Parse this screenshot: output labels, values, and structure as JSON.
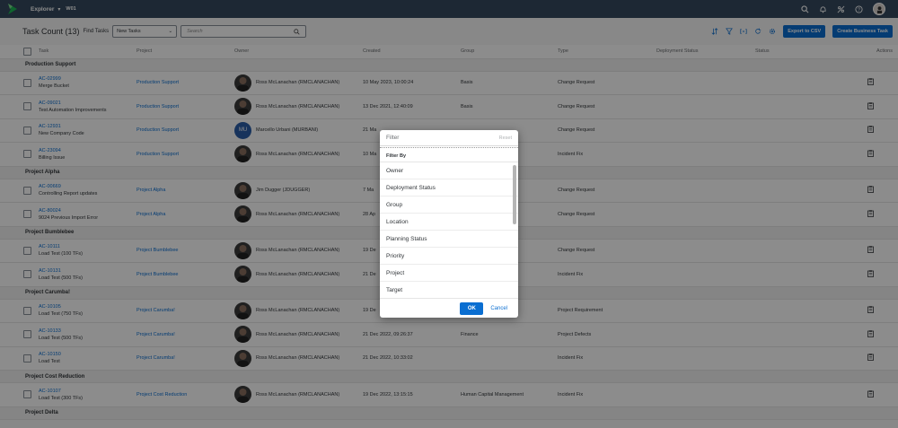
{
  "shell": {
    "app_title": "Explorer",
    "app_sub": "W01",
    "icons": [
      "search-icon",
      "bell-icon",
      "tasks-icon",
      "help-icon"
    ]
  },
  "toolbar": {
    "count_label": "Task Count (13)",
    "find_label": "Find Tasks",
    "find_value": "New Tasks",
    "search_placeholder": "Search",
    "export_label": "Export to CSV",
    "create_label": "Create Business Task"
  },
  "columns": [
    "Task",
    "Project",
    "Owner",
    "Created",
    "Group",
    "Type",
    "Deployment Status",
    "Status",
    "Actions"
  ],
  "groups": [
    {
      "name": "Production Support",
      "rows": [
        {
          "id": "AC-02999",
          "name": "Merge Bucket",
          "project": "Production Support",
          "owner": "Ross McLanachan (RMCLANACHAN)",
          "initials": "",
          "created": "10 May 2023, 10:00:24",
          "group": "Basis",
          "type": "Change Request"
        },
        {
          "id": "AC-09021",
          "name": "Test Automation Improvements",
          "project": "Production Support",
          "owner": "Ross McLanachan (RMCLANACHAN)",
          "initials": "",
          "created": "13 Dec 2021, 12:40:09",
          "group": "Basis",
          "type": "Change Request"
        },
        {
          "id": "AC-12931",
          "name": "New Company Code",
          "project": "Production Support",
          "owner": "Marcello Urbani (MURBANI)",
          "initials": "MU",
          "created": "21 Ma",
          "group": "",
          "type": "Change Request"
        },
        {
          "id": "AC-23094",
          "name": "Billing Issue",
          "project": "Production Support",
          "owner": "Ross McLanachan (RMCLANACHAN)",
          "initials": "",
          "created": "10 Ma",
          "group": "",
          "type": "Incident Fix"
        }
      ]
    },
    {
      "name": "Project Alpha",
      "rows": [
        {
          "id": "AC-00669",
          "name": "Controlling Report updates",
          "project": "Project Alpha",
          "owner": "Jim Dugger (JDUGGER)",
          "initials": "",
          "created": "7 Ma",
          "group": "",
          "type": "Change Request"
        },
        {
          "id": "AC-80024",
          "name": "9024 Previous Import Error",
          "project": "Project Alpha",
          "owner": "Ross McLanachan (RMCLANACHAN)",
          "initials": "",
          "created": "28 Ap",
          "group": "",
          "type": "Change Request"
        }
      ]
    },
    {
      "name": "Project Bumblebee",
      "rows": [
        {
          "id": "AC-10111",
          "name": "Load Test (100 TFs)",
          "project": "Project Bumblebee",
          "owner": "Ross McLanachan (RMCLANACHAN)",
          "initials": "",
          "created": "19 De",
          "group": "",
          "type": "Change Request"
        },
        {
          "id": "AC-10131",
          "name": "Load Test (500 TFs)",
          "project": "Project Bumblebee",
          "owner": "Ross McLanachan (RMCLANACHAN)",
          "initials": "",
          "created": "21 De",
          "group": "",
          "type": "Incident Fix"
        }
      ]
    },
    {
      "name": "Project Carumba!",
      "rows": [
        {
          "id": "AC-10105",
          "name": "Load Test (750 TFs)",
          "project": "Project Carumba!",
          "owner": "Ross McLanachan (RMCLANACHAN)",
          "initials": "",
          "created": "19 De",
          "group": "",
          "type": "Project Requirement"
        },
        {
          "id": "AC-10133",
          "name": "Load Test (500 TFs)",
          "project": "Project Carumba!",
          "owner": "Ross McLanachan (RMCLANACHAN)",
          "initials": "",
          "created": "21 Dec 2022, 09:26:37",
          "group": "Finance",
          "type": "Project Defects"
        },
        {
          "id": "AC-10150",
          "name": "Load Test",
          "project": "Project Carumba!",
          "owner": "Ross McLanachan (RMCLANACHAN)",
          "initials": "",
          "created": "21 Dec 2022, 10:33:02",
          "group": "",
          "type": "Incident Fix"
        }
      ]
    },
    {
      "name": "Project Cost Reduction",
      "rows": [
        {
          "id": "AC-10107",
          "name": "Load Test (300 TFs)",
          "project": "Project Cost Reduction",
          "owner": "Ross McLanachan (RMCLANACHAN)",
          "initials": "",
          "created": "19 Dec 2022, 13:15:15",
          "group": "Human Capital Management",
          "type": "Incident Fix"
        }
      ]
    },
    {
      "name": "Project Delta",
      "rows": []
    }
  ],
  "filter_dialog": {
    "title": "Filter",
    "reset_label": "Reset",
    "section_label": "Filter By",
    "items": [
      "Owner",
      "Deployment Status",
      "Group",
      "Location",
      "Planning Status",
      "Priority",
      "Project",
      "Target"
    ],
    "ok_label": "OK",
    "cancel_label": "Cancel"
  }
}
